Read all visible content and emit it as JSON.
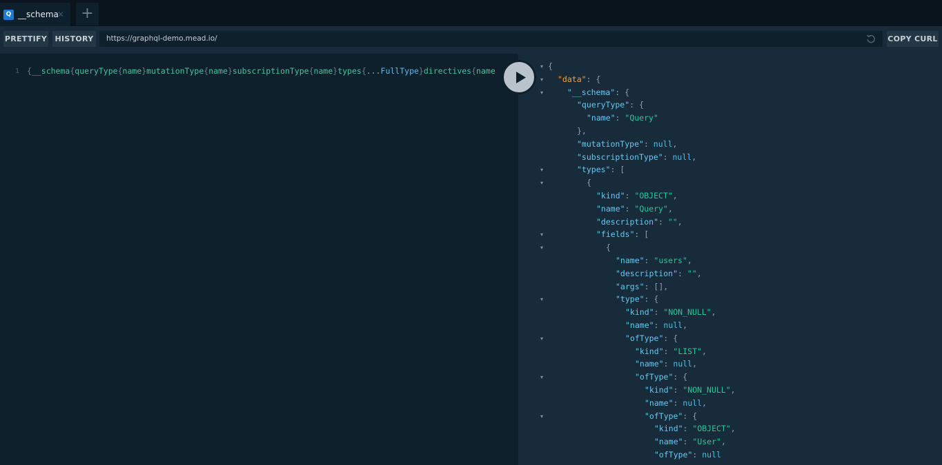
{
  "tabs": [
    {
      "badge": "Q",
      "title": "__schema",
      "close": "✕"
    }
  ],
  "tab_add": "+",
  "toolbar": {
    "prettify": "PRETTIFY",
    "history": "HISTORY",
    "url": "https://graphql-demo.mead.io/",
    "copy_curl": "COPY CURL"
  },
  "editor": {
    "line_number": "1",
    "query_tokens": [
      {
        "t": "{",
        "c": "brace"
      },
      {
        "t": "__schema",
        "c": "kw"
      },
      {
        "t": "{",
        "c": "brace"
      },
      {
        "t": "queryType",
        "c": "kw"
      },
      {
        "t": "{",
        "c": "brace"
      },
      {
        "t": "name",
        "c": "kw"
      },
      {
        "t": "}",
        "c": "brace"
      },
      {
        "t": "mutationType",
        "c": "kw"
      },
      {
        "t": "{",
        "c": "brace"
      },
      {
        "t": "name",
        "c": "kw"
      },
      {
        "t": "}",
        "c": "brace"
      },
      {
        "t": "subscriptionType",
        "c": "kw"
      },
      {
        "t": "{",
        "c": "brace"
      },
      {
        "t": "name",
        "c": "kw"
      },
      {
        "t": "}",
        "c": "brace"
      },
      {
        "t": "types",
        "c": "kw"
      },
      {
        "t": "{",
        "c": "brace"
      },
      {
        "t": "...",
        "c": "spread"
      },
      {
        "t": "FullType",
        "c": "frag"
      },
      {
        "t": "}",
        "c": "brace"
      },
      {
        "t": "directives",
        "c": "kw"
      },
      {
        "t": "{",
        "c": "brace"
      },
      {
        "t": "name",
        "c": "kw"
      }
    ]
  },
  "result_lines": [
    {
      "indent": 0,
      "fold": true,
      "parts": [
        [
          "p",
          "{"
        ]
      ]
    },
    {
      "indent": 1,
      "fold": true,
      "parts": [
        [
          "kd",
          "\"data\""
        ],
        [
          "p",
          ": {"
        ]
      ]
    },
    {
      "indent": 2,
      "fold": true,
      "parts": [
        [
          "k",
          "\"__schema\""
        ],
        [
          "p",
          ": {"
        ]
      ]
    },
    {
      "indent": 3,
      "fold": false,
      "parts": [
        [
          "k",
          "\"queryType\""
        ],
        [
          "p",
          ": {"
        ]
      ]
    },
    {
      "indent": 4,
      "fold": false,
      "parts": [
        [
          "k",
          "\"name\""
        ],
        [
          "p",
          ": "
        ],
        [
          "s",
          "\"Query\""
        ]
      ]
    },
    {
      "indent": 3,
      "fold": false,
      "parts": [
        [
          "p",
          "},"
        ]
      ]
    },
    {
      "indent": 3,
      "fold": false,
      "parts": [
        [
          "k",
          "\"mutationType\""
        ],
        [
          "p",
          ": "
        ],
        [
          "n",
          "null"
        ],
        [
          "p",
          ","
        ]
      ]
    },
    {
      "indent": 3,
      "fold": false,
      "parts": [
        [
          "k",
          "\"subscriptionType\""
        ],
        [
          "p",
          ": "
        ],
        [
          "n",
          "null"
        ],
        [
          "p",
          ","
        ]
      ]
    },
    {
      "indent": 3,
      "fold": true,
      "parts": [
        [
          "k",
          "\"types\""
        ],
        [
          "p",
          ": ["
        ]
      ]
    },
    {
      "indent": 4,
      "fold": true,
      "parts": [
        [
          "p",
          "{"
        ]
      ]
    },
    {
      "indent": 5,
      "fold": false,
      "parts": [
        [
          "k",
          "\"kind\""
        ],
        [
          "p",
          ": "
        ],
        [
          "s",
          "\"OBJECT\""
        ],
        [
          "p",
          ","
        ]
      ]
    },
    {
      "indent": 5,
      "fold": false,
      "parts": [
        [
          "k",
          "\"name\""
        ],
        [
          "p",
          ": "
        ],
        [
          "s",
          "\"Query\""
        ],
        [
          "p",
          ","
        ]
      ]
    },
    {
      "indent": 5,
      "fold": false,
      "parts": [
        [
          "k",
          "\"description\""
        ],
        [
          "p",
          ": "
        ],
        [
          "s",
          "\"\""
        ],
        [
          "p",
          ","
        ]
      ]
    },
    {
      "indent": 5,
      "fold": true,
      "parts": [
        [
          "k",
          "\"fields\""
        ],
        [
          "p",
          ": ["
        ]
      ]
    },
    {
      "indent": 6,
      "fold": true,
      "parts": [
        [
          "p",
          "{"
        ]
      ]
    },
    {
      "indent": 7,
      "fold": false,
      "parts": [
        [
          "k",
          "\"name\""
        ],
        [
          "p",
          ": "
        ],
        [
          "s",
          "\"users\""
        ],
        [
          "p",
          ","
        ]
      ]
    },
    {
      "indent": 7,
      "fold": false,
      "parts": [
        [
          "k",
          "\"description\""
        ],
        [
          "p",
          ": "
        ],
        [
          "s",
          "\"\""
        ],
        [
          "p",
          ","
        ]
      ]
    },
    {
      "indent": 7,
      "fold": false,
      "parts": [
        [
          "k",
          "\"args\""
        ],
        [
          "p",
          ": [],"
        ]
      ]
    },
    {
      "indent": 7,
      "fold": true,
      "parts": [
        [
          "k",
          "\"type\""
        ],
        [
          "p",
          ": {"
        ]
      ]
    },
    {
      "indent": 8,
      "fold": false,
      "parts": [
        [
          "k",
          "\"kind\""
        ],
        [
          "p",
          ": "
        ],
        [
          "s",
          "\"NON_NULL\""
        ],
        [
          "p",
          ","
        ]
      ]
    },
    {
      "indent": 8,
      "fold": false,
      "parts": [
        [
          "k",
          "\"name\""
        ],
        [
          "p",
          ": "
        ],
        [
          "n",
          "null"
        ],
        [
          "p",
          ","
        ]
      ]
    },
    {
      "indent": 8,
      "fold": true,
      "parts": [
        [
          "k",
          "\"ofType\""
        ],
        [
          "p",
          ": {"
        ]
      ]
    },
    {
      "indent": 9,
      "fold": false,
      "parts": [
        [
          "k",
          "\"kind\""
        ],
        [
          "p",
          ": "
        ],
        [
          "s",
          "\"LIST\""
        ],
        [
          "p",
          ","
        ]
      ]
    },
    {
      "indent": 9,
      "fold": false,
      "parts": [
        [
          "k",
          "\"name\""
        ],
        [
          "p",
          ": "
        ],
        [
          "n",
          "null"
        ],
        [
          "p",
          ","
        ]
      ]
    },
    {
      "indent": 9,
      "fold": true,
      "parts": [
        [
          "k",
          "\"ofType\""
        ],
        [
          "p",
          ": {"
        ]
      ]
    },
    {
      "indent": 10,
      "fold": false,
      "parts": [
        [
          "k",
          "\"kind\""
        ],
        [
          "p",
          ": "
        ],
        [
          "s",
          "\"NON_NULL\""
        ],
        [
          "p",
          ","
        ]
      ]
    },
    {
      "indent": 10,
      "fold": false,
      "parts": [
        [
          "k",
          "\"name\""
        ],
        [
          "p",
          ": "
        ],
        [
          "n",
          "null"
        ],
        [
          "p",
          ","
        ]
      ]
    },
    {
      "indent": 10,
      "fold": true,
      "parts": [
        [
          "k",
          "\"ofType\""
        ],
        [
          "p",
          ": {"
        ]
      ]
    },
    {
      "indent": 11,
      "fold": false,
      "parts": [
        [
          "k",
          "\"kind\""
        ],
        [
          "p",
          ": "
        ],
        [
          "s",
          "\"OBJECT\""
        ],
        [
          "p",
          ","
        ]
      ]
    },
    {
      "indent": 11,
      "fold": false,
      "parts": [
        [
          "k",
          "\"name\""
        ],
        [
          "p",
          ": "
        ],
        [
          "s",
          "\"User\""
        ],
        [
          "p",
          ","
        ]
      ]
    },
    {
      "indent": 11,
      "fold": false,
      "parts": [
        [
          "k",
          "\"ofType\""
        ],
        [
          "p",
          ": "
        ],
        [
          "n",
          "null"
        ]
      ]
    }
  ],
  "icons": {
    "fold": "caret-down-icon",
    "run": "play-icon",
    "reload": "reload-icon",
    "add": "plus-icon",
    "close": "close-icon"
  }
}
